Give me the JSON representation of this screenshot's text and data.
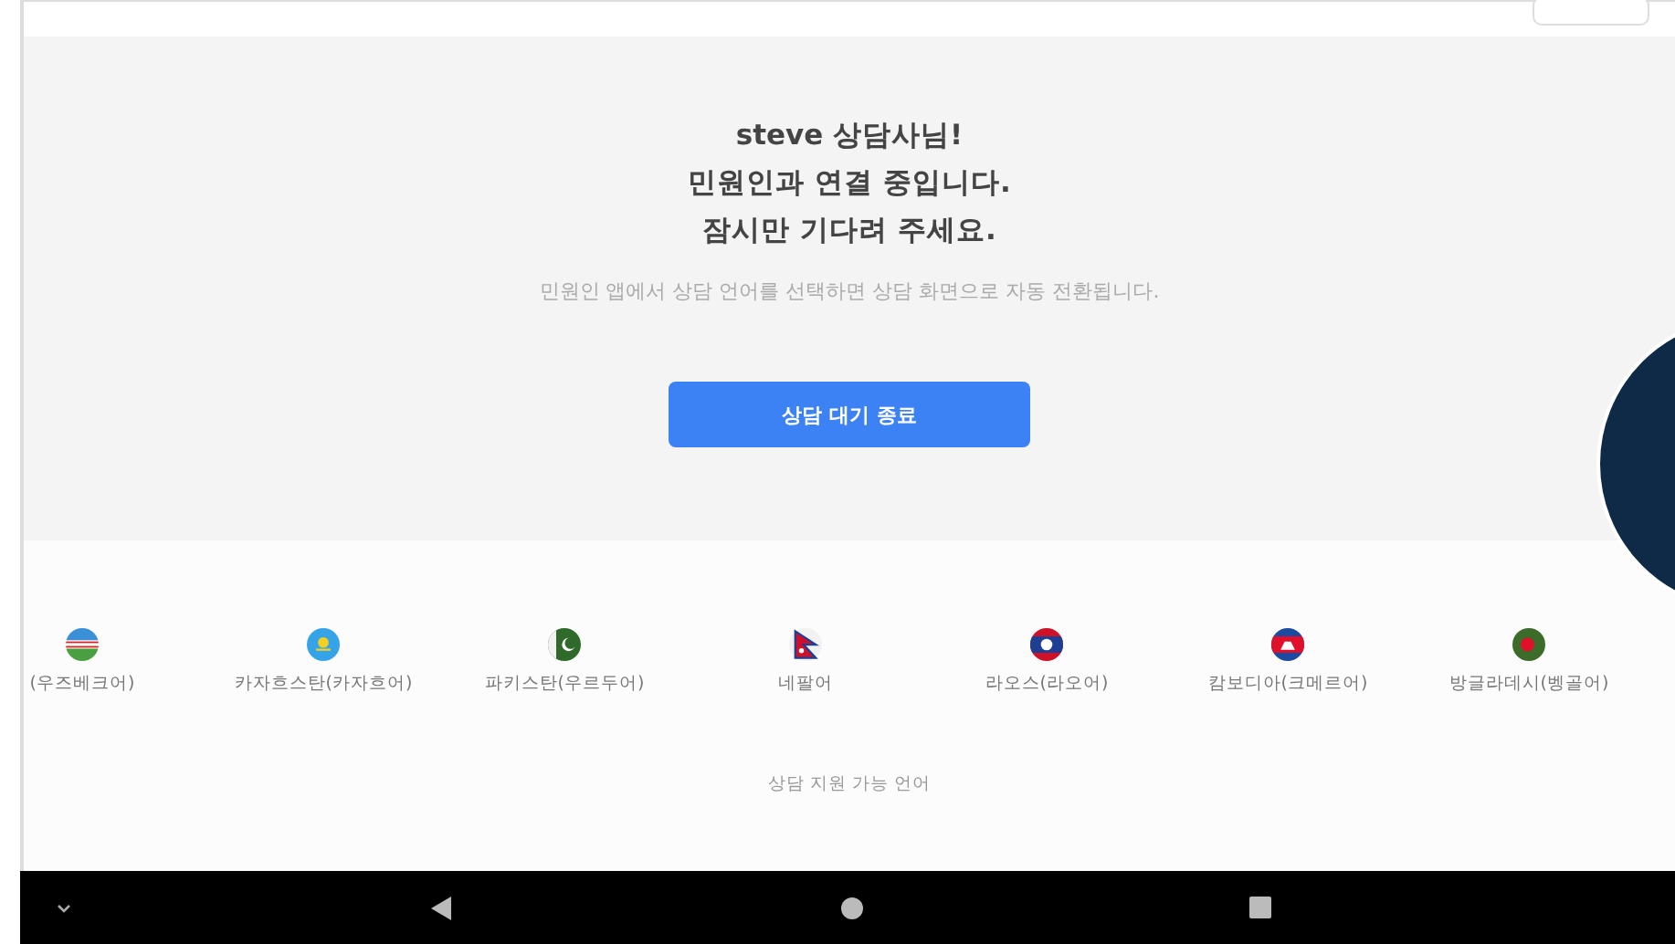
{
  "greeting": {
    "lines": [
      "steve 상담사님!",
      "민원인과 연결 중입니다.",
      "잠시만 기다려 주세요."
    ],
    "hint": "민원인 앱에서 상담 언어를 선택하면 상담 화면으로 자동 전환됩니다.",
    "button": "상담 대기 종료"
  },
  "languages": [
    {
      "kind": "uz",
      "label": "(우즈베크어)"
    },
    {
      "kind": "kz",
      "label": "카자흐스탄(카자흐어)"
    },
    {
      "kind": "pk",
      "label": "파키스탄(우르두어)"
    },
    {
      "kind": "np",
      "label": "네팔어"
    },
    {
      "kind": "la",
      "label": "라오스(라오어)"
    },
    {
      "kind": "kh",
      "label": "캄보디아(크메르어)"
    },
    {
      "kind": "bd",
      "label": "방글라데시(벵골어)"
    }
  ],
  "languages_caption": "상담 지원 가능 언어"
}
